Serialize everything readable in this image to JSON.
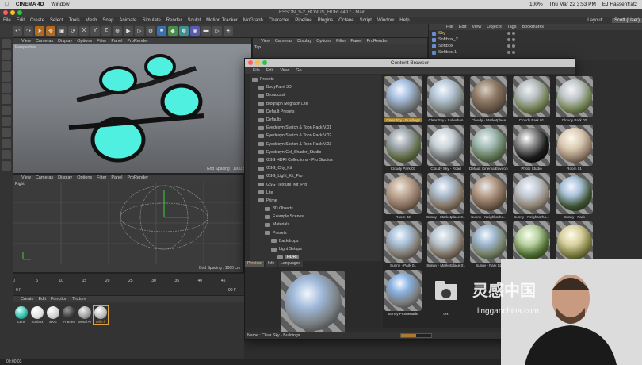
{
  "mac_menu": {
    "apple": "",
    "app": "CINEMA 4D",
    "window": "Window",
    "clock": "Thu Mar 22 3:53 PM",
    "user": "EJ Hassenfratz",
    "battery": "100%"
  },
  "window_title": "LESSON_9-2_BONUS_HDRI.c4d * - Main",
  "main_menu": [
    "File",
    "Edit",
    "Create",
    "Select",
    "Tools",
    "Mesh",
    "Snap",
    "Animate",
    "Simulate",
    "Render",
    "Sculpt",
    "Motion Tracker",
    "MoGraph",
    "Character",
    "Pipeline",
    "Plugins",
    "Octane",
    "Script",
    "Window",
    "Help"
  ],
  "layout": {
    "label": "Layout:",
    "value": "Scott (User)"
  },
  "viewport_menu": [
    "View",
    "Cameras",
    "Display",
    "Options",
    "Filter",
    "Panel",
    "ProRender"
  ],
  "viewports": {
    "perspective": "Perspective",
    "top": "Top",
    "right": "Right",
    "grid_spacing": "Grid Spacing : 1000 cm"
  },
  "object_manager": {
    "menu": [
      "File",
      "Edit",
      "View",
      "Objects",
      "Tags",
      "Bookmarks"
    ],
    "objects": [
      "Sky",
      "Softbox_2",
      "Softbox",
      "Softbox.1"
    ]
  },
  "content_browser": {
    "title": "Content Browser",
    "menu": [
      "File",
      "Edit",
      "View",
      "Go"
    ],
    "tree": [
      "Presets",
      "BodyPaint 3D",
      "Broadcast",
      "Biograph Mograph Lite",
      "Default Presets",
      "Defaults",
      "Eyedesyn Sketch & Toon Pack V.01",
      "Eyedesyn Sketch & Toon Pack V.02",
      "Eyedesyn Sketch & Toon Pack V.03",
      "Eyedesyn Cel_Shader_Studio",
      "GSG HDRI Collections - Pro Studios",
      "GSG_City_Kit",
      "GSG_Light_Kit_Pro",
      "GSG_Texture_Kit_Pro",
      "Lite",
      "Prime",
      "3D Objects",
      "Example Scenes",
      "Materials",
      "Presets",
      "Backdrops",
      "Light Setups",
      "HDRI"
    ],
    "grid": [
      "Clear Sky - Buildings",
      "Clear Sky - Suburban",
      "Cloudy - Marketplace",
      "Cloudy Park 01",
      "Cloudy Park 02",
      "Cloudy Park 03",
      "Cloudy Sky - Road",
      "Default Cinema Environ.",
      "Photo Studio",
      "Room 01",
      "Room 02",
      "Sunny - Marketplace 0...",
      "Sunny - Neighborho...",
      "Sunny - Neighborho...",
      "Sunny - Park",
      "Sunny - Park 01",
      "Sunny - Marketplace 01",
      "Sunny - Park 02",
      "Sunny - Park 03",
      "Sunny - Park 04",
      "Sunny Promenade",
      "tex"
    ],
    "preview_tabs": [
      "Preview",
      "Info",
      "Languages"
    ],
    "status": "Name : Clear Sky - Buildings",
    "zoom": 0.5
  },
  "timeline": {
    "ticks": [
      "0",
      "5",
      "10",
      "15",
      "20",
      "25",
      "30",
      "35",
      "40",
      "45"
    ],
    "frame": "0 F",
    "end": "90 F"
  },
  "materials": {
    "menu": [
      "Create",
      "Edit",
      "Function",
      "Texture"
    ],
    "items": [
      "Lens",
      "Softbox",
      "BKG",
      "Frames",
      "Metal Ar",
      "refle.fl"
    ]
  },
  "bottom_status": "00:00:03",
  "watermark": {
    "line1": "灵感中国",
    "line2": "lingganchina.com"
  },
  "colors": {
    "accent": "#e0a23a",
    "lens": "#4ff0e0"
  }
}
